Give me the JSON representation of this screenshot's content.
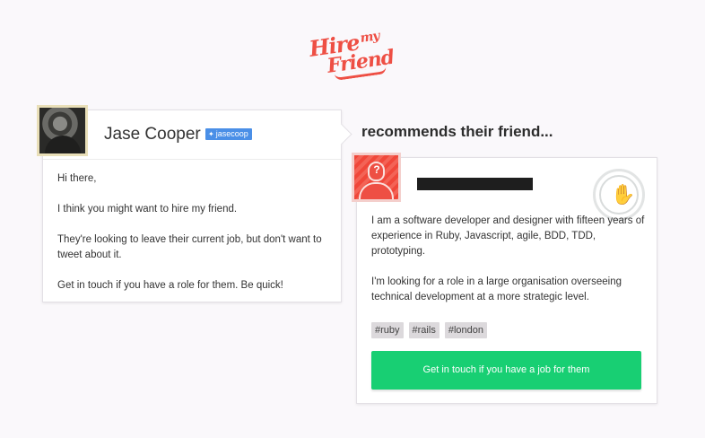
{
  "logo": {
    "line1": "Hire",
    "line1_small": "my",
    "line2": "Friend"
  },
  "sender": {
    "name": "Jase Cooper",
    "twitter_handle": "jasecoop"
  },
  "message": {
    "greeting": "Hi there,",
    "line1": "I think you might want to hire my friend.",
    "line2": "They're looking to leave their current job, but don't want to tweet about it.",
    "line3": "Get in touch if you have a role for them. Be quick!"
  },
  "recommends_heading": "recommends their friend...",
  "friend": {
    "avatar_mark": "?",
    "bio_p1": "I am a software developer and designer with fifteen years of experience in Ruby, Javascript, agile, BDD, TDD, prototyping.",
    "bio_p2": "I'm looking for a role in a large organisation overseeing technical development at a more strategic level.",
    "tags": [
      "#ruby",
      "#rails",
      "#london"
    ],
    "cta_label": "Get in touch if you have a job for them"
  },
  "colors": {
    "brand": "#ee4f44",
    "cta": "#18cf73",
    "twitter": "#4a8fe7"
  }
}
